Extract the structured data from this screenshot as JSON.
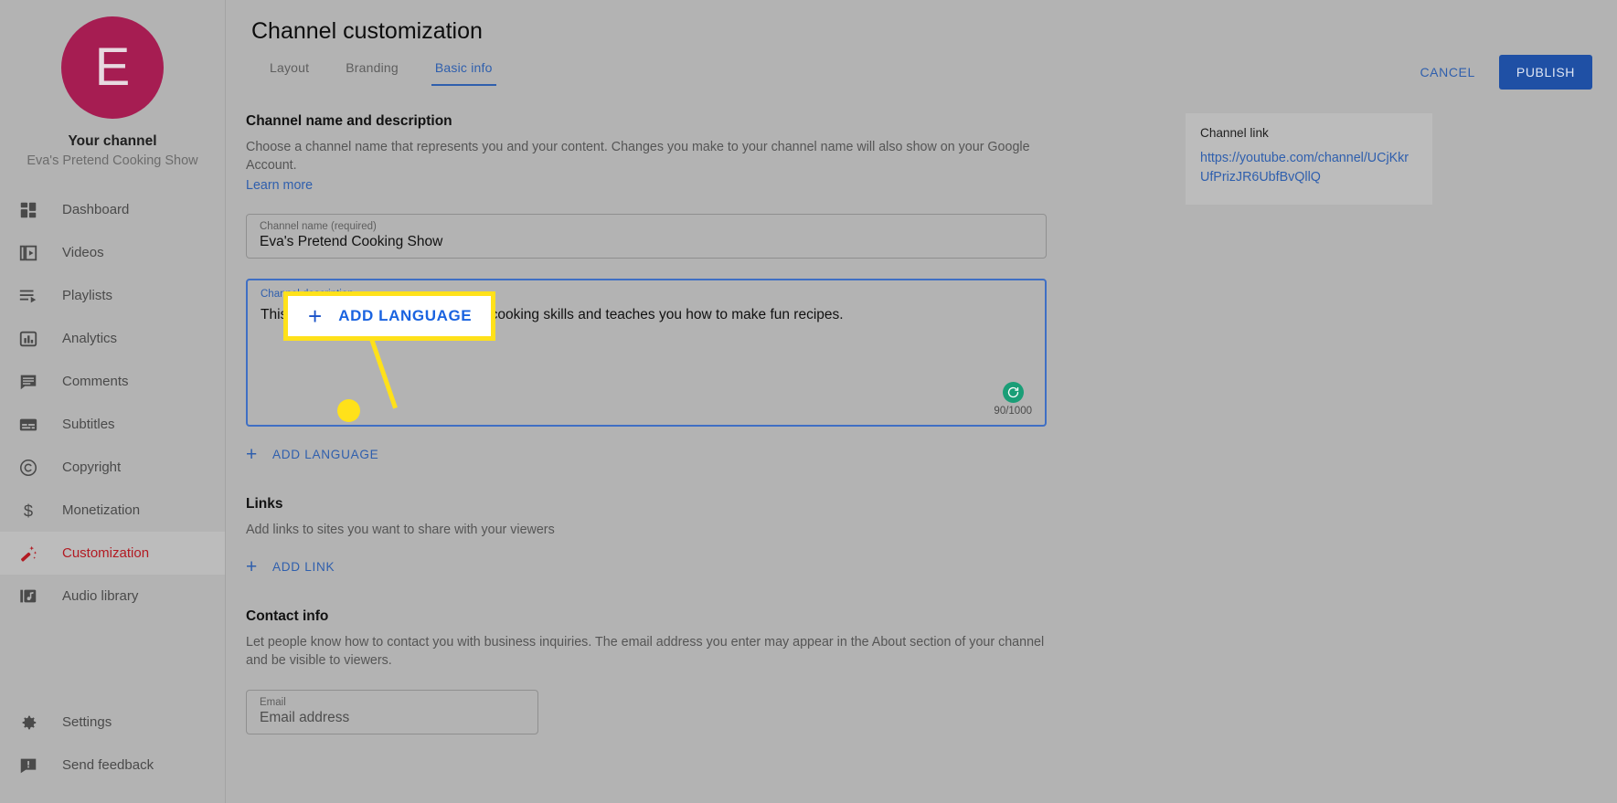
{
  "sidebar": {
    "avatar_letter": "E",
    "your_channel_label": "Your channel",
    "channel_name": "Eva's Pretend Cooking Show",
    "items": [
      {
        "label": "Dashboard",
        "icon": "dashboard-icon"
      },
      {
        "label": "Videos",
        "icon": "videos-icon"
      },
      {
        "label": "Playlists",
        "icon": "playlists-icon"
      },
      {
        "label": "Analytics",
        "icon": "analytics-icon"
      },
      {
        "label": "Comments",
        "icon": "comments-icon"
      },
      {
        "label": "Subtitles",
        "icon": "subtitles-icon"
      },
      {
        "label": "Copyright",
        "icon": "copyright-icon"
      },
      {
        "label": "Monetization",
        "icon": "monetization-icon"
      },
      {
        "label": "Customization",
        "icon": "magic-wand-icon"
      },
      {
        "label": "Audio library",
        "icon": "audio-library-icon"
      }
    ],
    "active_item": "Customization",
    "bottom_items": [
      {
        "label": "Settings",
        "icon": "gear-icon"
      },
      {
        "label": "Send feedback",
        "icon": "feedback-icon"
      }
    ]
  },
  "header": {
    "title": "Channel customization",
    "tabs": [
      {
        "label": "Layout",
        "active": false
      },
      {
        "label": "Branding",
        "active": false
      },
      {
        "label": "Basic info",
        "active": true
      }
    ],
    "cancel_label": "CANCEL",
    "publish_label": "PUBLISH"
  },
  "main": {
    "name_section": {
      "title": "Channel name and description",
      "description": "Choose a channel name that represents you and your content. Changes you make to your channel name will also show on your Google Account.",
      "learn_more": "Learn more"
    },
    "channel_name_field": {
      "label": "Channel name (required)",
      "value": "Eva's Pretend Cooking Show"
    },
    "channel_description_field": {
      "label": "Channel description",
      "value": "This YouTube channel shows off my cooking skills and teaches you how to make fun recipes.",
      "counter": "90/1000",
      "badge_icon": "translate-refresh-icon"
    },
    "add_language_label": "ADD LANGUAGE",
    "links_section": {
      "title": "Links",
      "description": "Add links to sites you want to share with your viewers",
      "add_link_label": "ADD LINK"
    },
    "contact_section": {
      "title": "Contact info",
      "description": "Let people know how to contact you with business inquiries. The email address you enter may appear in the About section of your channel and be visible to viewers.",
      "email_label": "Email",
      "email_placeholder": "Email address"
    }
  },
  "channel_link_card": {
    "label": "Channel link",
    "url": "https://youtube.com/channel/UCjKkrUfPrizJR6UbfBvQllQ"
  },
  "callout": {
    "plus": "+",
    "label": "ADD LANGUAGE"
  },
  "colors": {
    "accent_blue": "#2f5fad",
    "publish_blue": "#1f50a5",
    "active_red": "#b21a22",
    "avatar_magenta": "#a61d52",
    "highlight_yellow": "#ffe11a",
    "badge_green": "#1a9e77"
  }
}
